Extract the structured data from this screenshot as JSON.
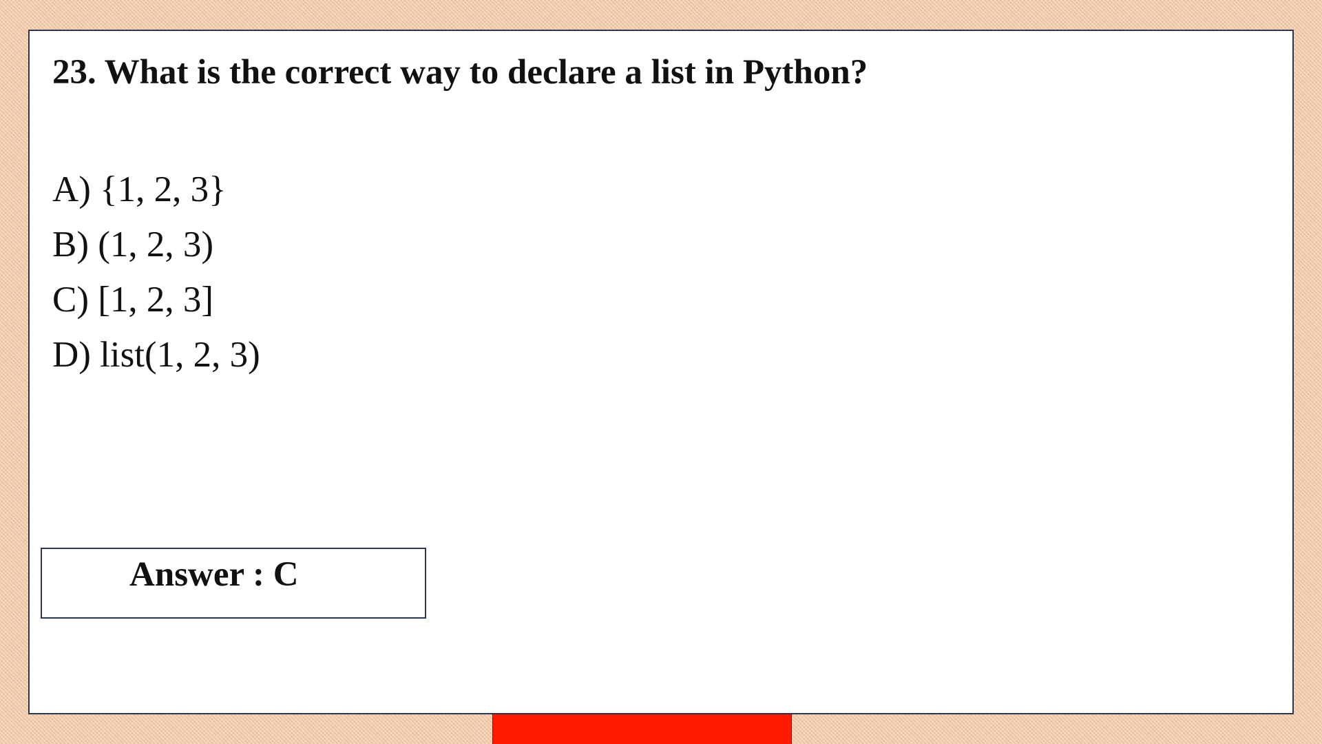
{
  "question": {
    "text": "23. What is the correct way to declare a list in Python?"
  },
  "options": [
    {
      "text": "A) {1, 2, 3}"
    },
    {
      "text": "B) (1, 2, 3)"
    },
    {
      "text": "C) [1, 2, 3]"
    },
    {
      "text": "D) list(1, 2, 3)"
    }
  ],
  "answer": {
    "text": "Answer : C"
  },
  "colors": {
    "background": "#f2c9a6",
    "card": "#ffffff",
    "border": "#2b3552",
    "accent_tab": "#ff1a00"
  }
}
